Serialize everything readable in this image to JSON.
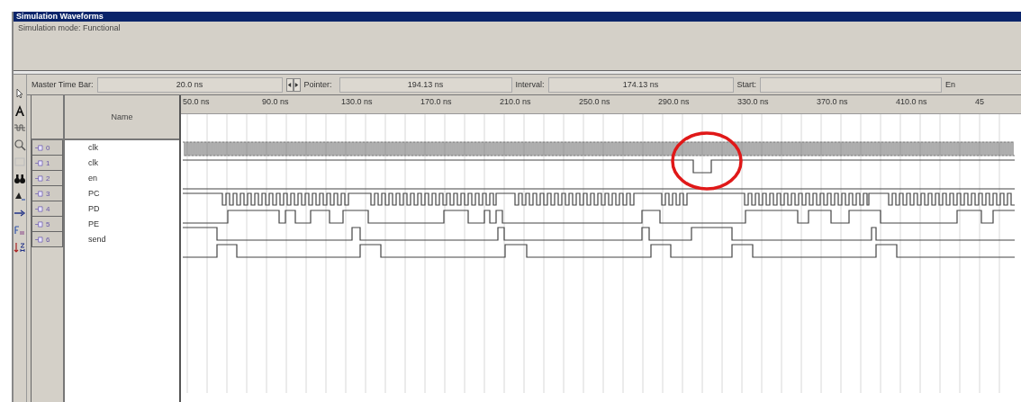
{
  "window": {
    "title": "Simulation Waveforms"
  },
  "mode_text": "Simulation mode: Functional",
  "time_bar": {
    "master_label": "Master Time Bar:",
    "master_value": "20.0 ns",
    "pointer_label": "Pointer:",
    "pointer_value": "194.13 ns",
    "interval_label": "Interval:",
    "interval_value": "174.13 ns",
    "start_label": "Start:",
    "end_label": "En"
  },
  "ruler": [
    "50.0 ns",
    "90.0 ns",
    "130.0 ns",
    "170.0 ns",
    "210.0 ns",
    "250.0 ns",
    "290.0 ns",
    "330.0 ns",
    "370.0 ns",
    "410.0 ns",
    "45"
  ],
  "name_header": "Name",
  "signals": [
    {
      "index": "0",
      "name": "clk"
    },
    {
      "index": "1",
      "name": "clk"
    },
    {
      "index": "2",
      "name": "en"
    },
    {
      "index": "3",
      "name": "PC"
    },
    {
      "index": "4",
      "name": "PD"
    },
    {
      "index": "5",
      "name": "PE"
    },
    {
      "index": "6",
      "name": "send"
    }
  ]
}
